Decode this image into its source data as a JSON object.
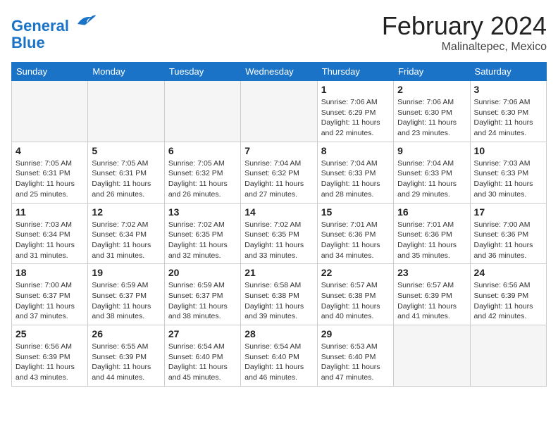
{
  "header": {
    "logo_line1": "General",
    "logo_line2": "Blue",
    "month": "February 2024",
    "location": "Malinaltepec, Mexico"
  },
  "weekdays": [
    "Sunday",
    "Monday",
    "Tuesday",
    "Wednesday",
    "Thursday",
    "Friday",
    "Saturday"
  ],
  "rows": [
    [
      {
        "day": "",
        "info": ""
      },
      {
        "day": "",
        "info": ""
      },
      {
        "day": "",
        "info": ""
      },
      {
        "day": "",
        "info": ""
      },
      {
        "day": "1",
        "info": "Sunrise: 7:06 AM\nSunset: 6:29 PM\nDaylight: 11 hours\nand 22 minutes."
      },
      {
        "day": "2",
        "info": "Sunrise: 7:06 AM\nSunset: 6:30 PM\nDaylight: 11 hours\nand 23 minutes."
      },
      {
        "day": "3",
        "info": "Sunrise: 7:06 AM\nSunset: 6:30 PM\nDaylight: 11 hours\nand 24 minutes."
      }
    ],
    [
      {
        "day": "4",
        "info": "Sunrise: 7:05 AM\nSunset: 6:31 PM\nDaylight: 11 hours\nand 25 minutes."
      },
      {
        "day": "5",
        "info": "Sunrise: 7:05 AM\nSunset: 6:31 PM\nDaylight: 11 hours\nand 26 minutes."
      },
      {
        "day": "6",
        "info": "Sunrise: 7:05 AM\nSunset: 6:32 PM\nDaylight: 11 hours\nand 26 minutes."
      },
      {
        "day": "7",
        "info": "Sunrise: 7:04 AM\nSunset: 6:32 PM\nDaylight: 11 hours\nand 27 minutes."
      },
      {
        "day": "8",
        "info": "Sunrise: 7:04 AM\nSunset: 6:33 PM\nDaylight: 11 hours\nand 28 minutes."
      },
      {
        "day": "9",
        "info": "Sunrise: 7:04 AM\nSunset: 6:33 PM\nDaylight: 11 hours\nand 29 minutes."
      },
      {
        "day": "10",
        "info": "Sunrise: 7:03 AM\nSunset: 6:33 PM\nDaylight: 11 hours\nand 30 minutes."
      }
    ],
    [
      {
        "day": "11",
        "info": "Sunrise: 7:03 AM\nSunset: 6:34 PM\nDaylight: 11 hours\nand 31 minutes."
      },
      {
        "day": "12",
        "info": "Sunrise: 7:02 AM\nSunset: 6:34 PM\nDaylight: 11 hours\nand 31 minutes."
      },
      {
        "day": "13",
        "info": "Sunrise: 7:02 AM\nSunset: 6:35 PM\nDaylight: 11 hours\nand 32 minutes."
      },
      {
        "day": "14",
        "info": "Sunrise: 7:02 AM\nSunset: 6:35 PM\nDaylight: 11 hours\nand 33 minutes."
      },
      {
        "day": "15",
        "info": "Sunrise: 7:01 AM\nSunset: 6:36 PM\nDaylight: 11 hours\nand 34 minutes."
      },
      {
        "day": "16",
        "info": "Sunrise: 7:01 AM\nSunset: 6:36 PM\nDaylight: 11 hours\nand 35 minutes."
      },
      {
        "day": "17",
        "info": "Sunrise: 7:00 AM\nSunset: 6:36 PM\nDaylight: 11 hours\nand 36 minutes."
      }
    ],
    [
      {
        "day": "18",
        "info": "Sunrise: 7:00 AM\nSunset: 6:37 PM\nDaylight: 11 hours\nand 37 minutes."
      },
      {
        "day": "19",
        "info": "Sunrise: 6:59 AM\nSunset: 6:37 PM\nDaylight: 11 hours\nand 38 minutes."
      },
      {
        "day": "20",
        "info": "Sunrise: 6:59 AM\nSunset: 6:37 PM\nDaylight: 11 hours\nand 38 minutes."
      },
      {
        "day": "21",
        "info": "Sunrise: 6:58 AM\nSunset: 6:38 PM\nDaylight: 11 hours\nand 39 minutes."
      },
      {
        "day": "22",
        "info": "Sunrise: 6:57 AM\nSunset: 6:38 PM\nDaylight: 11 hours\nand 40 minutes."
      },
      {
        "day": "23",
        "info": "Sunrise: 6:57 AM\nSunset: 6:39 PM\nDaylight: 11 hours\nand 41 minutes."
      },
      {
        "day": "24",
        "info": "Sunrise: 6:56 AM\nSunset: 6:39 PM\nDaylight: 11 hours\nand 42 minutes."
      }
    ],
    [
      {
        "day": "25",
        "info": "Sunrise: 6:56 AM\nSunset: 6:39 PM\nDaylight: 11 hours\nand 43 minutes."
      },
      {
        "day": "26",
        "info": "Sunrise: 6:55 AM\nSunset: 6:39 PM\nDaylight: 11 hours\nand 44 minutes."
      },
      {
        "day": "27",
        "info": "Sunrise: 6:54 AM\nSunset: 6:40 PM\nDaylight: 11 hours\nand 45 minutes."
      },
      {
        "day": "28",
        "info": "Sunrise: 6:54 AM\nSunset: 6:40 PM\nDaylight: 11 hours\nand 46 minutes."
      },
      {
        "day": "29",
        "info": "Sunrise: 6:53 AM\nSunset: 6:40 PM\nDaylight: 11 hours\nand 47 minutes."
      },
      {
        "day": "",
        "info": ""
      },
      {
        "day": "",
        "info": ""
      }
    ]
  ]
}
